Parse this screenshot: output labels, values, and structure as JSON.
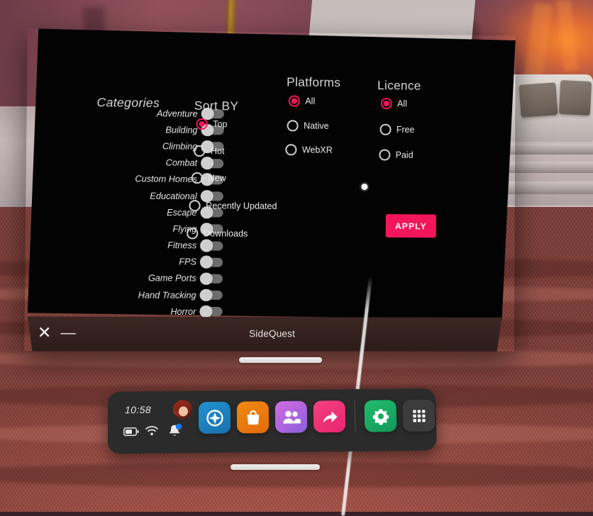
{
  "environment": {
    "name": "vr-home-environment",
    "description": "canyon-sunset-patio"
  },
  "window": {
    "title": "SideQuest",
    "close_label": "✕",
    "minimize_label": "—",
    "close_icon": "close-icon",
    "minimize_icon": "minimize-icon"
  },
  "filters": {
    "categories": {
      "heading": "Categories",
      "items": [
        {
          "label": "Adventure",
          "enabled": false
        },
        {
          "label": "Building",
          "enabled": false
        },
        {
          "label": "Climbing",
          "enabled": false
        },
        {
          "label": "Combat",
          "enabled": false
        },
        {
          "label": "Custom Homes",
          "enabled": false
        },
        {
          "label": "Educational",
          "enabled": false
        },
        {
          "label": "Escape",
          "enabled": false
        },
        {
          "label": "Flying",
          "enabled": false
        },
        {
          "label": "Fitness",
          "enabled": false
        },
        {
          "label": "FPS",
          "enabled": false
        },
        {
          "label": "Game Ports",
          "enabled": false
        },
        {
          "label": "Hand Tracking",
          "enabled": false
        },
        {
          "label": "Horror",
          "enabled": false
        }
      ]
    },
    "sort_by": {
      "heading": "Sort BY",
      "selected": "Top",
      "options": [
        {
          "label": "Top",
          "selected": true
        },
        {
          "label": "Hot",
          "selected": false
        },
        {
          "label": "New",
          "selected": false
        },
        {
          "label": "Recently Updated",
          "selected": false
        },
        {
          "label": "Downloads",
          "selected": false
        }
      ]
    },
    "platforms": {
      "heading": "Platforms",
      "selected": "All",
      "options": [
        {
          "label": "All",
          "selected": true
        },
        {
          "label": "Native",
          "selected": false
        },
        {
          "label": "WebXR",
          "selected": false
        }
      ]
    },
    "licence": {
      "heading": "Licence",
      "selected": "All",
      "options": [
        {
          "label": "All",
          "selected": true
        },
        {
          "label": "Free",
          "selected": false
        },
        {
          "label": "Paid",
          "selected": false
        }
      ]
    },
    "apply_label": "APPLY"
  },
  "taskbar": {
    "time": "10:58",
    "avatar_name": "user-avatar",
    "status_icons": [
      {
        "name": "battery-icon"
      },
      {
        "name": "wifi-icon"
      },
      {
        "name": "notifications-bell-icon",
        "badge": true
      }
    ],
    "apps": [
      {
        "name": "explore-icon",
        "label": "Explore",
        "color": "#1e86c4"
      },
      {
        "name": "store-bag-icon",
        "label": "Store",
        "color": "#ef7c13"
      },
      {
        "name": "people-icon",
        "label": "People",
        "color": "#b957d9"
      },
      {
        "name": "share-arrow-icon",
        "label": "Sharing",
        "color": "#f0357e"
      },
      {
        "name": "settings-gear-icon",
        "label": "Settings",
        "color": "#17a861"
      },
      {
        "name": "app-grid-icon",
        "label": "Apps",
        "color": "#3c3c3c"
      }
    ]
  },
  "colors": {
    "accent_pink": "#f4165a",
    "panel_background": "#030303",
    "taskbar_background": "#2b2b2b",
    "titlebar": "#33211e"
  }
}
